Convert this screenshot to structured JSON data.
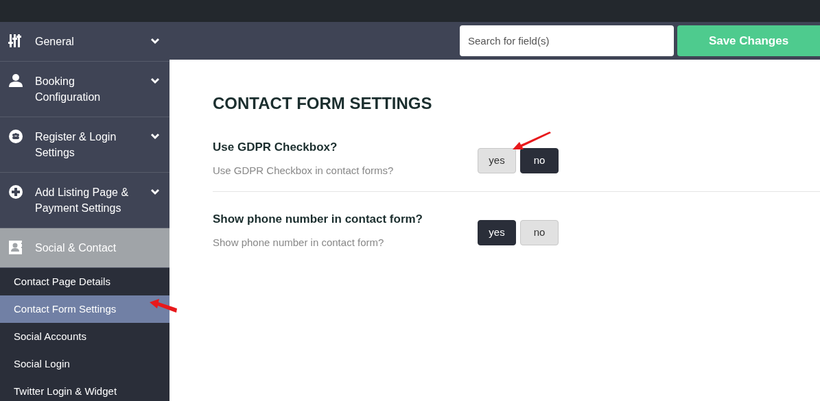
{
  "sidebar": {
    "sections": [
      {
        "label": "General",
        "expanded": false,
        "selected": false
      },
      {
        "label": "Booking Configuration",
        "expanded": false,
        "selected": false
      },
      {
        "label": "Register & Login Settings",
        "expanded": false,
        "selected": false
      },
      {
        "label": "Add Listing Page & Payment Settings",
        "expanded": false,
        "selected": false
      },
      {
        "label": "Social & Contact",
        "expanded": true,
        "selected": true,
        "children": [
          {
            "label": "Contact Page Details",
            "selected": false
          },
          {
            "label": "Contact Form Settings",
            "selected": true
          },
          {
            "label": "Social Accounts",
            "selected": false
          },
          {
            "label": "Social Login",
            "selected": false
          },
          {
            "label": "Twitter Login & Widget",
            "selected": false
          }
        ]
      }
    ]
  },
  "search": {
    "placeholder": "Search for field(s)"
  },
  "save_button": "Save Changes",
  "page_title": "CONTACT FORM SETTINGS",
  "settings": [
    {
      "title": "Use GDPR Checkbox?",
      "description": "Use GDPR Checkbox in contact forms?",
      "options": [
        {
          "label": "yes",
          "selected": false
        },
        {
          "label": "no",
          "selected": true
        }
      ]
    },
    {
      "title": "Show phone number in contact form?",
      "description": "Show phone number in contact form?",
      "options": [
        {
          "label": "yes",
          "selected": true
        },
        {
          "label": "no",
          "selected": false
        }
      ]
    }
  ]
}
